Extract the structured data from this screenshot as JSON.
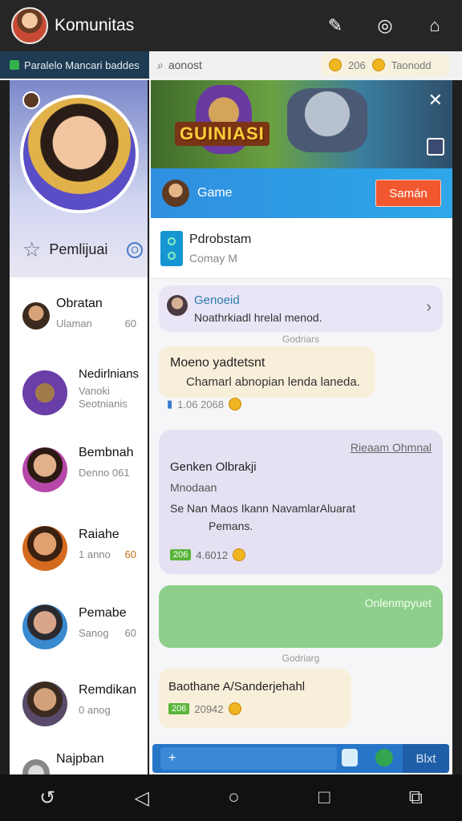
{
  "app": {
    "title": "Komunitas"
  },
  "strip": {
    "banner": "Paralelo Mancari baddes",
    "search": "aonost",
    "coins_a": "206",
    "coins_b": "Taonodd"
  },
  "sidebar": {
    "profile_label": "Pemlijuai",
    "contacts": [
      {
        "name": "Obratan",
        "sub": "Ulaman",
        "time": "60"
      },
      {
        "name": "Nedirlnians",
        "sub": "Vanoki\nSeotnianis",
        "time": ""
      },
      {
        "name": "Bembnah",
        "sub": "Denno 061",
        "time": ""
      },
      {
        "name": "Raiahe",
        "sub": "1 anno",
        "time": "60"
      },
      {
        "name": "Pemabe",
        "sub": "Sanog",
        "time": "60"
      },
      {
        "name": "Remdikan",
        "sub": "0 anog",
        "time": ""
      },
      {
        "name": "Najpban",
        "sub": "",
        "time": ""
      }
    ]
  },
  "banner": {
    "title": "GUINIASI"
  },
  "gamebar": {
    "label": "Game",
    "button": "Samán"
  },
  "group": {
    "name": "Pdrobstam",
    "sub": "Comay M"
  },
  "messages": {
    "m1": {
      "sender": "Genoeid",
      "text": "Noathrkiadl hrelal menod."
    },
    "sep1": "Godriars",
    "m2": {
      "line1": "Moeno yadtetsnt",
      "line2": "Chamarl abnopian lenda laneda.",
      "meta": "1.06 2068"
    },
    "m3": {
      "right": "Rieaam Ohmnal",
      "head": "Genken Olbrakji",
      "s1": "Mnodaan",
      "s2": "Se Nan Maos Ikann NavamlarAluarat",
      "s3": "Pemans.",
      "meta": "4.6012",
      "tag": "206"
    },
    "m4": {
      "text": "Onlenmpyuet"
    },
    "sep2": "Godriarg",
    "m5": {
      "text": "Baothane A/Sanderjehahl",
      "meta": "20942",
      "tag": "206"
    }
  },
  "compose": {
    "placeholder": "+",
    "send": "Blxt"
  }
}
